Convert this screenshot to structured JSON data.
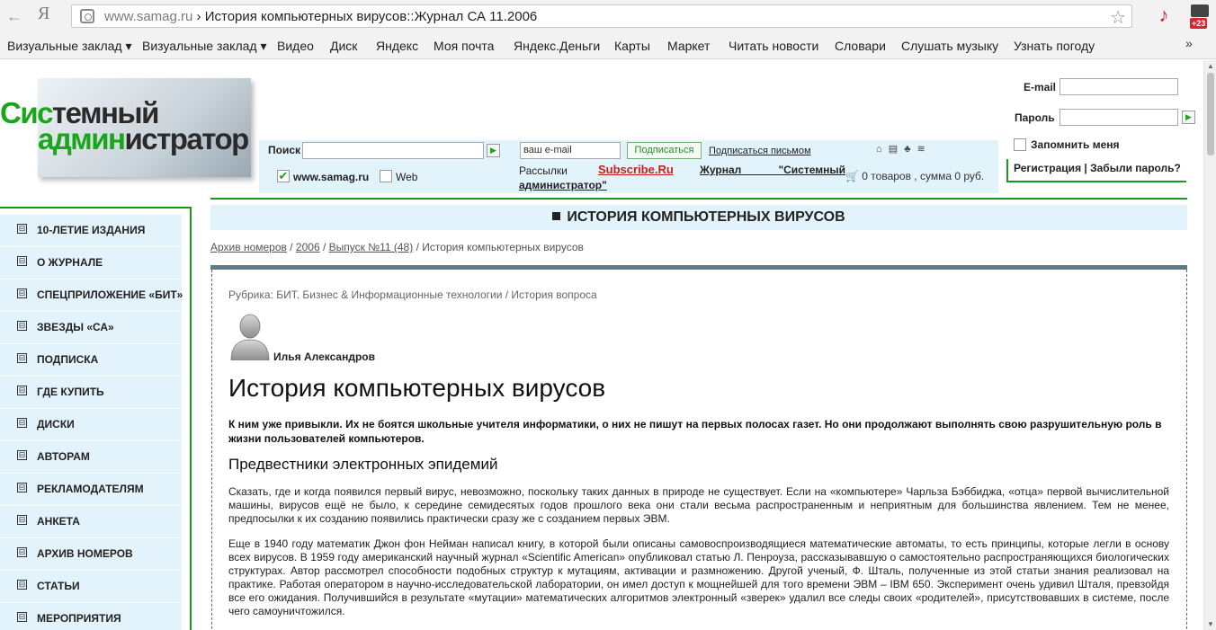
{
  "browser": {
    "logo": "Я",
    "url_domain": "www.samag.ru",
    "url_rest": " › История компьютерных вирусов::Журнал СА 11.2006",
    "ext_badge": "+23"
  },
  "bookmarks": [
    "Визуальные заклад ▾",
    "Визуальные заклад ▾",
    "Видео",
    "Диск",
    "Яндекс",
    "Моя почта",
    "Яндекс.Деньги",
    "Карты",
    "Маркет",
    "Читать новости",
    "Словари",
    "Слушать музыку",
    "Узнать погоду"
  ],
  "bookmarks_more": "»",
  "logo": {
    "line1_a": "Сис",
    "line1_b": "темный",
    "line2_a": "админ",
    "line2_b": "истратор"
  },
  "search": {
    "label": "Поиск",
    "opt_site": "www.samag.ru",
    "opt_web": "Web"
  },
  "subscribe": {
    "email_value": "ваш e-mail",
    "button": "Подписаться",
    "by_letter": "Подписаться письмом",
    "mailings": "Рассылки",
    "subscribe_ru": "Subscribe.Ru",
    "journal_1": "Журнал \"Системный",
    "journal_2": "администратор\""
  },
  "cart": "0 товаров , сумма 0 руб.",
  "login": {
    "email_label": "E-mail",
    "password_label": "Пароль",
    "remember": "Запомнить меня",
    "links": "Регистрация | Забыли пароль?"
  },
  "menu": [
    "10-ЛЕТИЕ ИЗДАНИЯ",
    "О ЖУРНАЛЕ",
    "СПЕЦПРИЛОЖЕНИЕ «БИТ»",
    "ЗВЕЗДЫ «СА»",
    "ПОДПИСКА",
    "ГДЕ КУПИТЬ",
    "ДИСКИ",
    "АВТОРАМ",
    "РЕКЛАМОДАТЕЛЯМ",
    "АНКЕТА",
    "АРХИВ НОМЕРОВ",
    "СТАТЬИ",
    "МЕРОПРИЯТИЯ"
  ],
  "article": {
    "section_title": "ИСТОРИЯ КОМПЬЮТЕРНЫХ ВИРУСОВ",
    "breadcrumb": {
      "archive": "Архив номеров",
      "sep": " / ",
      "year": "2006",
      "issue": "Выпуск №11 (48)",
      "current": "История компьютерных вирусов"
    },
    "rubric": "Рубрика: БИТ. Бизнес & Информационные технологии /  История вопроса",
    "author": "Илья Александров",
    "title": "История компьютерных вирусов",
    "lead": "К ним уже привыкли. Их не боятся школьные учителя информатики, о них не пишут на первых полосах газет. Но они продолжают выполнять свою разрушительную роль в жизни пользователей компьютеров.",
    "subtitle": "Предвестники электронных эпидемий",
    "p1": "Сказать, где и когда появился первый вирус, невозможно, поскольку таких данных в природе не существует. Если на «компьютере» Чарльза Бэббиджа, «отца» первой вычислительной машины, вирусов ещё не было, к середине семидесятых годов прошлого века они стали весьма распространенным и неприятным для большинства явлением. Тем не менее, предпосылки к их созданию появились практически сразу же с созданием первых ЭВМ.",
    "p2": "Еще в 1940 году математик Джон фон Нейман написал книгу, в которой были описаны самовоспроизводящиеся математические автоматы, то есть принципы, которые легли в основу всех вирусов. В 1959 году американский научный журнал «Scientific American» опубликовал статью Л. Пенроуза, рассказывавшую о самостоятельно распространяющихся биологических структурах. Автор рассмотрел способности подобных структур к мутациям, активации и размножению. Другой ученый, Ф. Шталь, полученные из этой статьи знания реализовал на практике. Работая оператором в научно-исследовательской лаборатории, он имел доступ к мощнейшей для того времени ЭВМ – IBM 650. Эксперимент очень удивил Шталя, превзойдя все его ожидания. Получившийся в результате «мутации» математических алгоритмов электронный «зверек» удалил все следы своих «родителей», присутствовавших в системе, после чего самоуничтожился."
  }
}
